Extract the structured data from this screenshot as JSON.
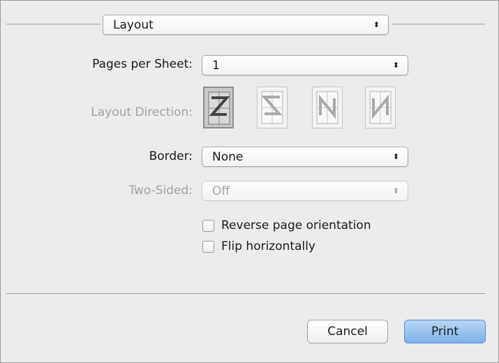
{
  "header": {
    "section_popup": "Layout",
    "arrows": "⬍"
  },
  "form": {
    "pages_per_sheet_label": "Pages per Sheet:",
    "pages_per_sheet_value": "1",
    "layout_direction_label": "Layout Direction:",
    "border_label": "Border:",
    "border_value": "None",
    "two_sided_label": "Two-Sided:",
    "two_sided_value": "Off"
  },
  "options": {
    "reverse_label": "Reverse page orientation",
    "flip_label": "Flip horizontally"
  },
  "buttons": {
    "cancel": "Cancel",
    "print": "Print"
  }
}
